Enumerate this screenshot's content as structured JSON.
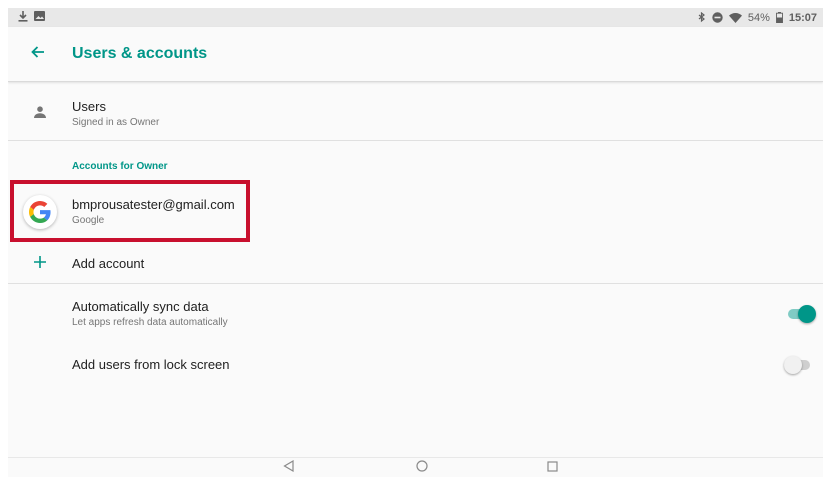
{
  "status_bar": {
    "left_icons": [
      "download-icon",
      "image-icon"
    ],
    "battery": "54%",
    "time": "15:07"
  },
  "app_bar": {
    "title": "Users & accounts",
    "back_icon": "arrow-back-icon"
  },
  "users": {
    "title": "Users",
    "subtitle": "Signed in as Owner",
    "icon": "person-icon"
  },
  "accounts_section": {
    "header": "Accounts for Owner"
  },
  "account": {
    "email": "bmprousatester@gmail.com",
    "provider": "Google",
    "icon": "google-logo-icon"
  },
  "add_account": {
    "label": "Add account",
    "icon": "plus-icon"
  },
  "auto_sync": {
    "title": "Automatically sync data",
    "subtitle": "Let apps refresh data automatically",
    "enabled": true
  },
  "lock_screen_users": {
    "title": "Add users from lock screen",
    "enabled": false
  },
  "nav_bar": {
    "buttons": [
      "back-triangle-icon",
      "home-circle-icon",
      "recents-square-icon"
    ]
  },
  "colors": {
    "accent": "#009688",
    "highlight": "#c8102e"
  }
}
